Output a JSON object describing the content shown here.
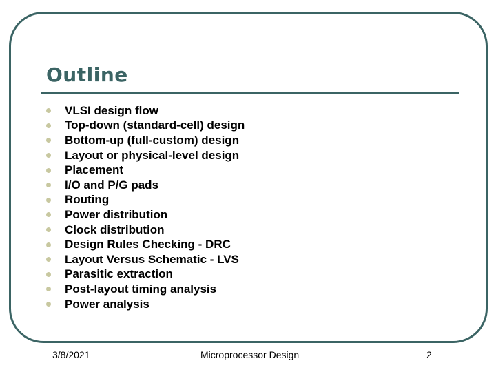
{
  "slide": {
    "title": "Outline",
    "bullets": [
      "VLSI design flow",
      "Top-down (standard-cell) design",
      "Bottom-up (full-custom) design",
      "Layout or physical-level design",
      "Placement",
      "I/O and P/G pads",
      "Routing",
      "Power distribution",
      "Clock distribution",
      "Design Rules Checking - DRC",
      "Layout Versus Schematic - LVS",
      "Parasitic extraction",
      "Post-layout timing analysis",
      "Power analysis"
    ],
    "bullet_icon": "round-dot-icon"
  },
  "footer": {
    "date": "3/8/2021",
    "title": "Microprocessor Design",
    "page": "2"
  },
  "colors": {
    "accent": "#3b6464",
    "bullet": "#c8c8a0"
  }
}
